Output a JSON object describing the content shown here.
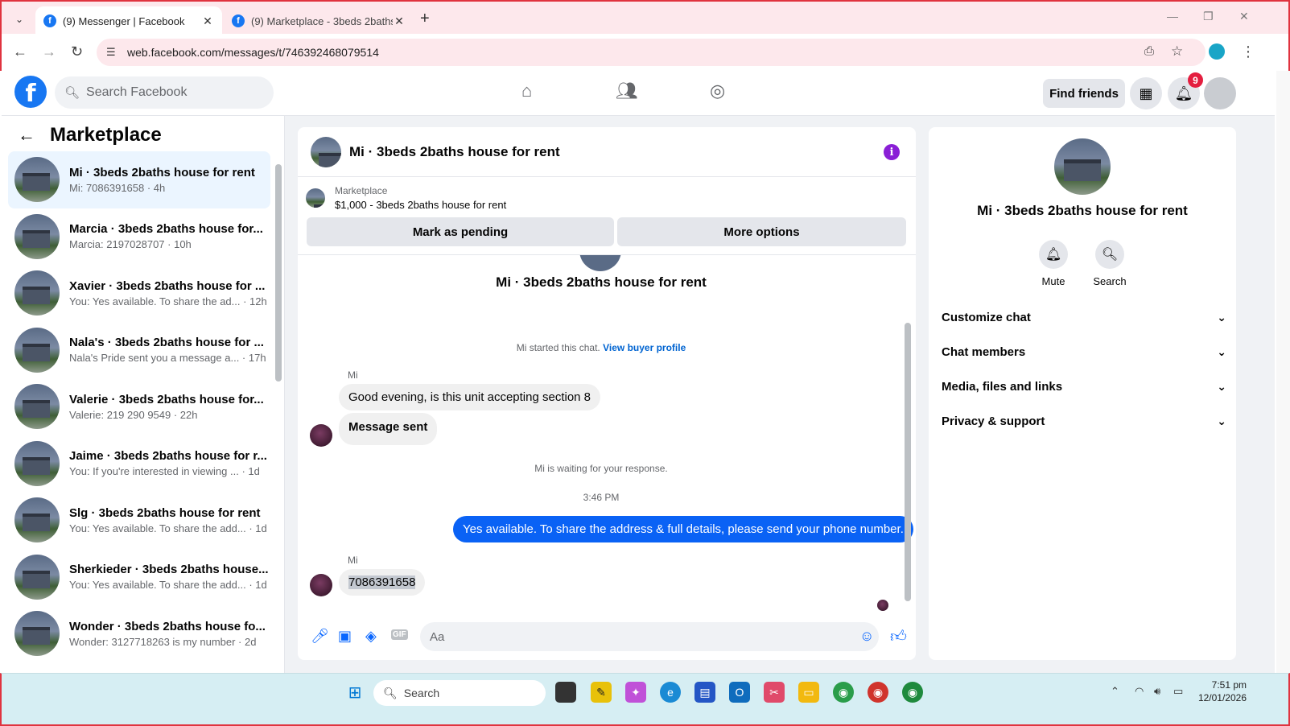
{
  "browser": {
    "tabs": [
      {
        "label": "(9) Messenger | Facebook",
        "active": true
      },
      {
        "label": "(9) Marketplace - 3beds 2baths",
        "active": false
      }
    ],
    "url": "web.facebook.com/messages/t/746392468079514",
    "new_tab": "+"
  },
  "fb_header": {
    "search_placeholder": "Search Facebook",
    "find_friends": "Find friends",
    "notification_count": "9"
  },
  "sidebar": {
    "title": "Marketplace",
    "conversations": [
      {
        "name": "Mi · 3beds 2baths house for rent",
        "preview": "Mi: 7086391658 · 4h",
        "active": true
      },
      {
        "name": "Marcia · 3beds 2baths house for...",
        "preview": "Marcia: 2197028707 · 10h"
      },
      {
        "name": "Xavier · 3beds 2baths house for ...",
        "preview": "You: Yes available. To share the ad... · 12h"
      },
      {
        "name": "Nala's · 3beds 2baths house for ...",
        "preview": "Nala's Pride sent you a message a... · 17h"
      },
      {
        "name": "Valerie · 3beds 2baths house for...",
        "preview": "Valerie: 219 290 9549 · 22h"
      },
      {
        "name": "Jaime · 3beds 2baths house for r...",
        "preview": "You: If you're interested in viewing ... · 1d"
      },
      {
        "name": "Slg · 3beds 2baths house for rent",
        "preview": "You: Yes available. To share the add... · 1d"
      },
      {
        "name": "Sherkieder · 3beds 2baths house...",
        "preview": "You: Yes available. To share the add... · 1d"
      },
      {
        "name": "Wonder · 3beds 2baths house fo...",
        "preview": "Wonder: 3127718263 is my number · 2d"
      }
    ]
  },
  "chat": {
    "title": "Mi · 3beds 2baths house for rent",
    "listing_label": "Marketplace",
    "listing_detail": "$1,000 - 3beds 2baths house for rent",
    "mark_pending": "Mark as pending",
    "more_options": "More options",
    "thread_title": "Mi · 3beds 2baths house for rent",
    "started_text": "Mi started this chat.",
    "buyer_profile_link": "View buyer profile",
    "sender_name": "Mi",
    "msg1": "Good evening, is this unit accepting section 8",
    "msg2": "Message sent",
    "waiting": "Mi is waiting for your response.",
    "timestamp": "3:46 PM",
    "msg_out": "Yes available. To share the address & full details, please send your phone number.",
    "sender_name2": "Mi",
    "msg3": "7086391658",
    "composer_placeholder": "Aa",
    "gif_label": "GIF"
  },
  "info_panel": {
    "name": "Mi · 3beds 2baths house for rent",
    "mute": "Mute",
    "search": "Search",
    "sections": [
      "Customize chat",
      "Chat members",
      "Media, files and links",
      "Privacy & support"
    ]
  },
  "taskbar": {
    "search": "Search",
    "time": "7:51 pm",
    "date": "12/01/2026"
  },
  "colors": {
    "fb_blue": "#1877f2",
    "bubble_out": "#0a62f5",
    "info_icon": "#8a1fd6",
    "badge": "#e41e3f"
  }
}
